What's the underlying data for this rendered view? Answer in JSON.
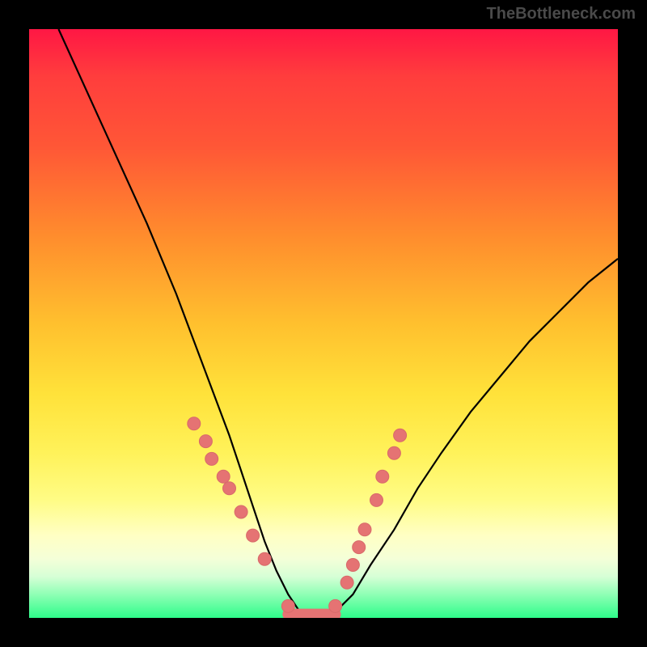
{
  "attribution": "TheBottleneck.com",
  "chart_data": {
    "type": "line",
    "title": "",
    "xlabel": "",
    "ylabel": "",
    "xlim": [
      0,
      100
    ],
    "ylim": [
      0,
      100
    ],
    "grid": false,
    "legend": false,
    "series": [
      {
        "name": "bottleneck-curve",
        "x": [
          5,
          10,
          15,
          20,
          25,
          28,
          31,
          34,
          36,
          38,
          40,
          42,
          44,
          46,
          48,
          50,
          52,
          55,
          58,
          62,
          66,
          70,
          75,
          80,
          85,
          90,
          95,
          100
        ],
        "y": [
          100,
          89,
          78,
          67,
          55,
          47,
          39,
          31,
          25,
          19,
          13,
          8,
          4,
          1,
          0,
          0,
          1,
          4,
          9,
          15,
          22,
          28,
          35,
          41,
          47,
          52,
          57,
          61
        ]
      }
    ],
    "markers": {
      "name": "sample-points",
      "x": [
        28,
        30,
        31,
        33,
        34,
        36,
        38,
        40,
        44,
        52,
        54,
        55,
        56,
        57,
        59,
        60,
        62,
        63
      ],
      "y": [
        33,
        30,
        27,
        24,
        22,
        18,
        14,
        10,
        2,
        2,
        6,
        9,
        12,
        15,
        20,
        24,
        28,
        31
      ]
    },
    "flat_segment": {
      "x0": 44,
      "x1": 52,
      "y": 0
    },
    "background_gradient": {
      "type": "vertical",
      "stops": [
        {
          "pos": 0.0,
          "color": "#ff1744"
        },
        {
          "pos": 0.5,
          "color": "#ffc02e"
        },
        {
          "pos": 0.8,
          "color": "#fffc85"
        },
        {
          "pos": 1.0,
          "color": "#2efc8a"
        }
      ]
    }
  }
}
